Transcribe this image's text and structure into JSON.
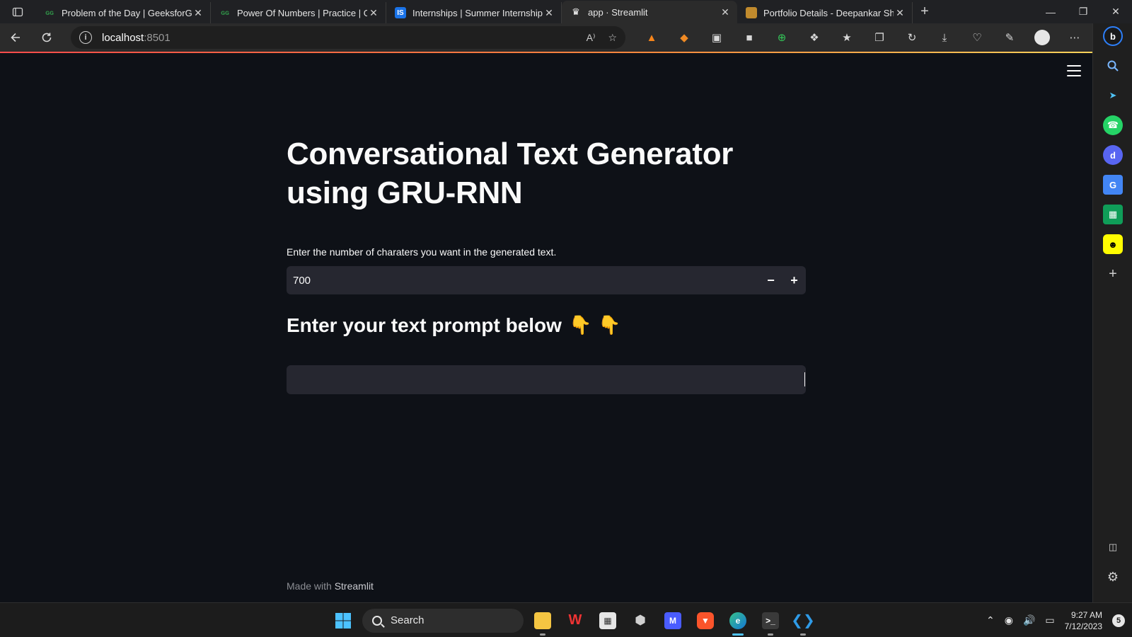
{
  "browser": {
    "tabs": [
      {
        "title": "Problem of the Day | GeeksforGe",
        "favicon": "GfG",
        "favicon_color": "#2f8d46",
        "active": false
      },
      {
        "title": "Power Of Numbers | Practice | Ge",
        "favicon": "GfG",
        "favicon_color": "#2f8d46",
        "active": false
      },
      {
        "title": "Internships | Summer Internship",
        "favicon": "IS",
        "favicon_color": "#1a73e8",
        "active": false
      },
      {
        "title": "app · Streamlit",
        "favicon": "crown",
        "favicon_color": "#ffffff",
        "active": true
      },
      {
        "title": "Portfolio Details - Deepankar Sha",
        "favicon": "portfolio",
        "favicon_color": "#c08a2d",
        "active": false
      }
    ],
    "address": {
      "host": "localhost",
      "port": ":8501"
    }
  },
  "app": {
    "title": "Conversational Text Generator using GRU-RNN",
    "number_input": {
      "label": "Enter the number of charaters you want in the generated text.",
      "value": "700",
      "minus": "−",
      "plus": "+"
    },
    "subheader": "Enter your text prompt below",
    "subheader_emoji": "👇 👇",
    "text_input": {
      "value": ""
    },
    "footer": {
      "prefix": "Made with",
      "brand": "Streamlit"
    }
  },
  "taskbar": {
    "search_label": "Search",
    "time": "9:27 AM",
    "date": "7/12/2023",
    "notifications": "5"
  },
  "colors": {
    "app_bg": "#0e1117",
    "widget_bg": "#262730",
    "accent": "#ff4b4b"
  }
}
